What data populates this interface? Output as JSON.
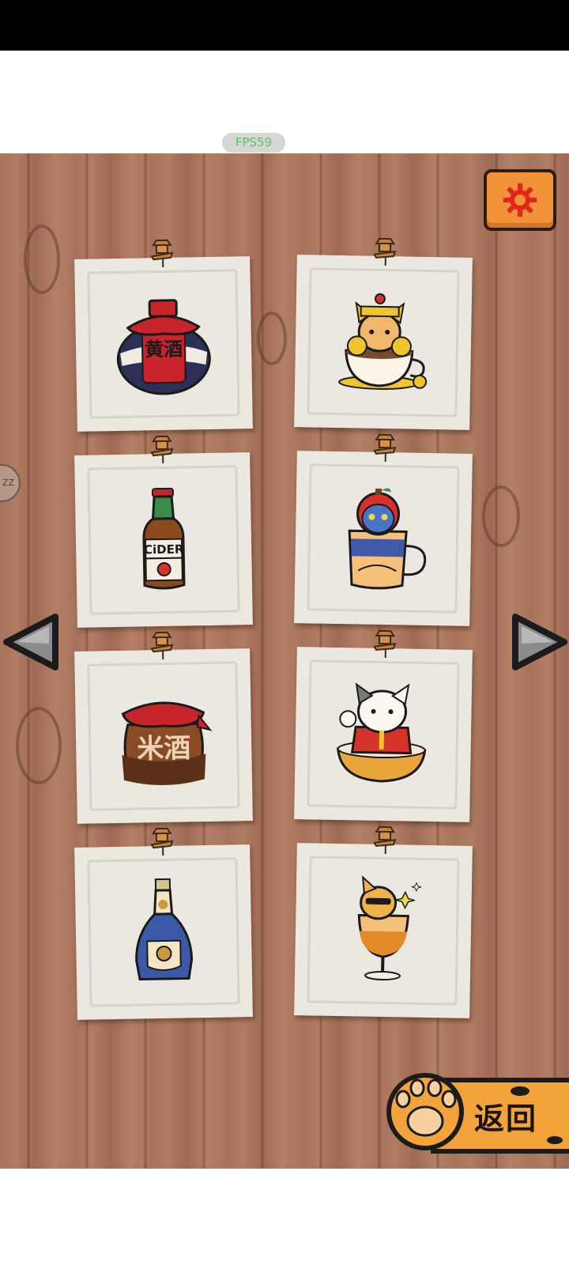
{
  "system": {
    "fps_label": "FPS59"
  },
  "side_tab": {
    "label": "ZZ"
  },
  "navigation": {
    "return_label": "返回"
  },
  "colors": {
    "wood": "#a8735c",
    "accent_orange": "#f2933a",
    "paper": "#ebe7e1",
    "fps_text": "#5cc35c"
  },
  "cards": [
    {
      "icon": "yellow-wine-jar-icon",
      "jar_text": "黄酒"
    },
    {
      "icon": "golden-cat-in-teacup-icon"
    },
    {
      "icon": "cider-bottle-icon",
      "bottle_text": "CiDER"
    },
    {
      "icon": "blue-cat-in-mug-icon"
    },
    {
      "icon": "rice-wine-jar-icon",
      "jar_text": "米酒"
    },
    {
      "icon": "calico-cat-in-bowl-icon"
    },
    {
      "icon": "blue-liquor-bottle-icon"
    },
    {
      "icon": "shiba-in-glass-icon"
    }
  ]
}
